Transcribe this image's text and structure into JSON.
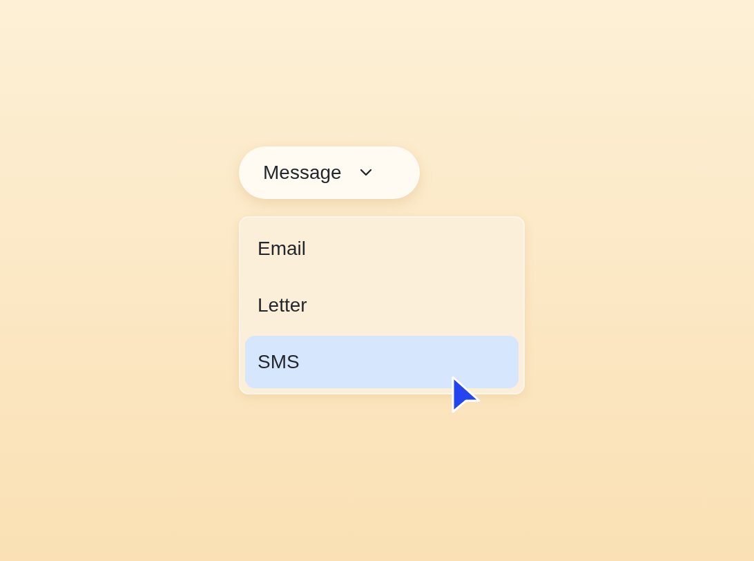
{
  "dropdown": {
    "label": "Message",
    "expanded": true,
    "options": [
      {
        "label": "Email",
        "selected": false
      },
      {
        "label": "Letter",
        "selected": false
      },
      {
        "label": "SMS",
        "selected": true
      }
    ]
  }
}
